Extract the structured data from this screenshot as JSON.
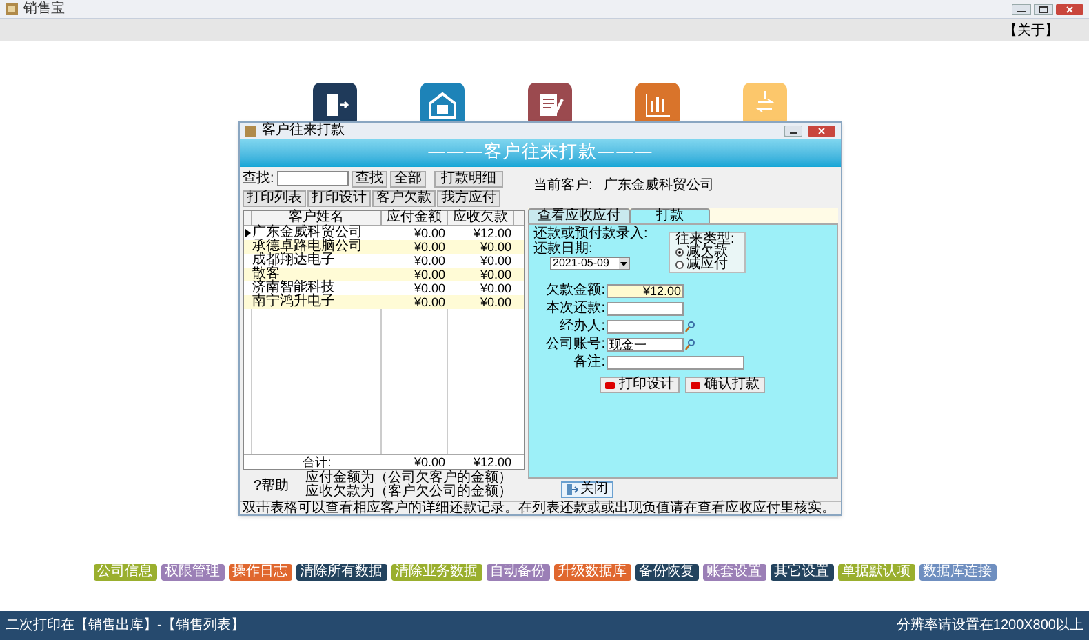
{
  "app": {
    "title": "销售宝",
    "about": "【关于】"
  },
  "dialog": {
    "title": "客户往来打款",
    "banner": "———客户往来打款———",
    "search": {
      "label": "查找:",
      "buttons": [
        "查找",
        "全部",
        "打款明细"
      ]
    },
    "toolbar": [
      "打印列表",
      "打印设计",
      "客户欠款",
      "我方应付"
    ],
    "table": {
      "columns": [
        "客户姓名",
        "应付金额",
        "应收欠款"
      ],
      "rows": [
        {
          "selected": true,
          "cells": [
            "广东金威科贸公司",
            "¥0.00",
            "¥12.00"
          ]
        },
        {
          "selected": false,
          "cells": [
            "承德卓路电脑公司",
            "¥0.00",
            "¥0.00"
          ]
        },
        {
          "selected": false,
          "cells": [
            "成都翔达电子",
            "¥0.00",
            "¥0.00"
          ]
        },
        {
          "selected": false,
          "cells": [
            "散客",
            "¥0.00",
            "¥0.00"
          ]
        },
        {
          "selected": false,
          "cells": [
            "济南智能科技",
            "¥0.00",
            "¥0.00"
          ]
        },
        {
          "selected": false,
          "cells": [
            "南宁鸿升电子",
            "¥0.00",
            "¥0.00"
          ]
        }
      ],
      "total": [
        "合计:",
        "¥0.00",
        "¥12.00"
      ]
    },
    "help": {
      "label": "?帮助",
      "lines": [
        "应付金额为（公司欠客户的金额）",
        "应收欠款为（客户欠公司的金额）"
      ]
    },
    "current_customer": {
      "label": "当前客户:",
      "value": "广东金威科贸公司"
    },
    "tabs": [
      {
        "label": "查看应收应付",
        "selected": false
      },
      {
        "label": "打款",
        "selected": true
      }
    ],
    "entry": {
      "title": "还款或预付款录入:",
      "date_label": "还款日期:",
      "date": "2021-05-09",
      "type_title": "往来类型:",
      "types": [
        {
          "label": "减欠款",
          "selected": true
        },
        {
          "label": "减应付",
          "selected": false
        }
      ],
      "fields": [
        {
          "label": "欠款金额:",
          "value": "¥12.00",
          "readonly": true,
          "lookup": false
        },
        {
          "label": "本次还款:",
          "readonly": false,
          "lookup": false
        },
        {
          "label": "经办人:",
          "readonly": false,
          "lookup": true
        },
        {
          "label": "公司账号:",
          "value": "现金一",
          "readonly": false,
          "lookup": true
        },
        {
          "label": "备注:",
          "readonly": false,
          "lookup": false,
          "wide": true
        }
      ],
      "buttons": [
        "打印设计",
        "确认打款"
      ]
    },
    "close": "关闭",
    "status": "双击表格可以查看相应客户的详细还款记录。在列表还款或或出现负值请在查看应收应付里核实。"
  },
  "buttons": [
    {
      "label": "公司信息",
      "color": "#9aaf2e"
    },
    {
      "label": "权限管理",
      "color": "#9b7fb6"
    },
    {
      "label": "操作日志",
      "color": "#e0672e"
    },
    {
      "label": "清除所有数据",
      "color": "#23435e"
    },
    {
      "label": "清除业务数据",
      "color": "#9aaf2e"
    },
    {
      "label": "自动备份",
      "color": "#9b7fb6"
    },
    {
      "label": "升级数据库",
      "color": "#e0672e"
    },
    {
      "label": "备份恢复",
      "color": "#23435e"
    },
    {
      "label": "账套设置",
      "color": "#9b7fb6"
    },
    {
      "label": "其它设置",
      "color": "#23435e"
    },
    {
      "label": "单据默认项",
      "color": "#9aaf2e"
    },
    {
      "label": "数据库连接",
      "color": "#6f8fc0"
    }
  ],
  "footer": {
    "left": "二次打印在【销售出库】-【销售列表】",
    "right": "分辨率请设置在1200X800以上"
  }
}
